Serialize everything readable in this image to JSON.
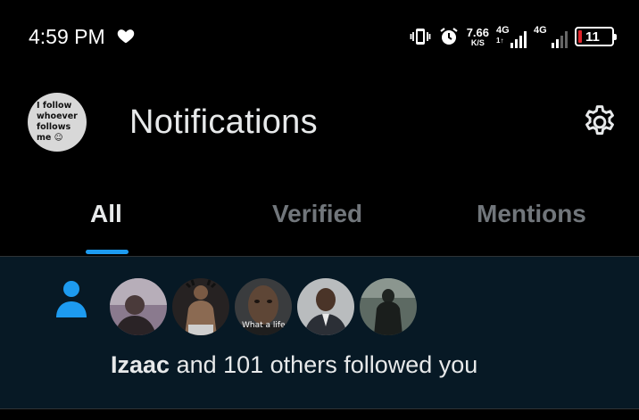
{
  "status_bar": {
    "time": "4:59 PM",
    "net_speed_value": "7.66",
    "net_speed_unit": "K/S",
    "sim1_label": "4G",
    "sim1_sub": "1↑",
    "sim2_label": "4G",
    "battery_level": "11",
    "battery_color": "#e0242a",
    "icons": [
      "heart-icon",
      "vibrate-icon",
      "alarm-icon",
      "signal-icon",
      "battery-icon"
    ]
  },
  "header": {
    "title": "Notifications",
    "profile_avatar_lines": [
      "I follow",
      "whoever",
      "follows",
      "me ☺"
    ],
    "settings_icon": "gear-icon"
  },
  "tabs": [
    {
      "label": "All",
      "active": true
    },
    {
      "label": "Verified",
      "active": false
    },
    {
      "label": "Mentions",
      "active": false
    }
  ],
  "notification": {
    "icon": "person-icon",
    "avatar_caption": "What a life",
    "actor": "Izaac",
    "rest": " and 101 others followed you",
    "accent_color": "#1d9bf0"
  }
}
